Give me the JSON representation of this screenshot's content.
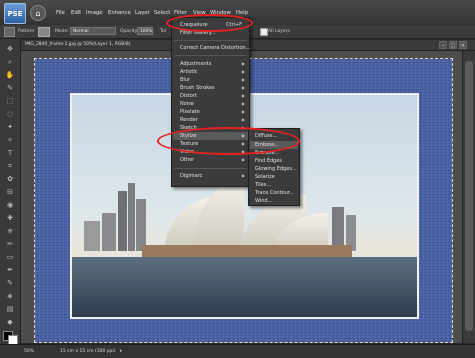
{
  "app": {
    "logo_text": "PSE",
    "menus": [
      "File",
      "Edit",
      "Image",
      "Enhance",
      "Layer",
      "Select",
      "Filter",
      "View",
      "Window",
      "Help"
    ]
  },
  "options_bar": {
    "pattern_label": "Pattern",
    "mode_label": "Mode:",
    "mode_value": "Normal",
    "opacity_label": "Opacity:",
    "opacity_value": "100%",
    "tol_label": "Tol",
    "contiguous_label": "guous",
    "all_layers_label": "All Layers"
  },
  "document": {
    "title": "IMG_2840_frame-1.jpg @ 50%(Layer 1, RGB/8)"
  },
  "status": {
    "zoom": "50%",
    "doc_size": "15 cm x 15 cm (300 ppi)"
  },
  "filter_menu": {
    "items": [
      {
        "label": "Craquelure",
        "shortcut": "Ctrl+F"
      },
      {
        "label": "Filter Gallery..."
      },
      {
        "label": "Correct Camera Distortion..."
      },
      {
        "label": "Adjustments",
        "submenu": true
      },
      {
        "label": "Artistic",
        "submenu": true
      },
      {
        "label": "Blur",
        "submenu": true
      },
      {
        "label": "Brush Strokes",
        "submenu": true
      },
      {
        "label": "Distort",
        "submenu": true
      },
      {
        "label": "Noise",
        "submenu": true
      },
      {
        "label": "Pixelate",
        "submenu": true
      },
      {
        "label": "Render",
        "submenu": true
      },
      {
        "label": "Sketch",
        "submenu": true
      },
      {
        "label": "Stylize",
        "submenu": true
      },
      {
        "label": "Texture",
        "submenu": true
      },
      {
        "label": "Video",
        "submenu": true
      },
      {
        "label": "Other",
        "submenu": true
      },
      {
        "label": "Digimarc",
        "submenu": true
      }
    ]
  },
  "stylize_submenu": {
    "items": [
      "Diffuse...",
      "Emboss...",
      "Extrude...",
      "Find Edges",
      "Glowing Edges...",
      "Solarize",
      "Tiles...",
      "Trace Contour...",
      "Wind..."
    ]
  },
  "colors": {
    "highlight_ring": "#e52222",
    "frame_blue": "#4a62a6"
  }
}
